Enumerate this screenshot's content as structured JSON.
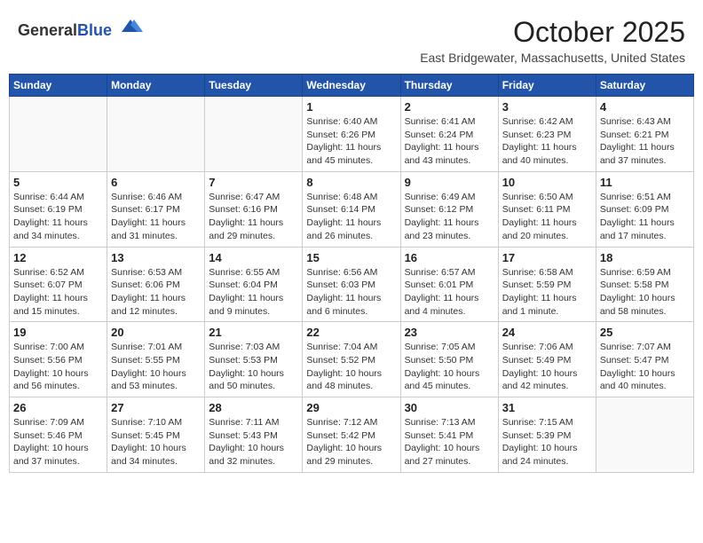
{
  "header": {
    "logo_general": "General",
    "logo_blue": "Blue",
    "month_title": "October 2025",
    "location": "East Bridgewater, Massachusetts, United States"
  },
  "weekdays": [
    "Sunday",
    "Monday",
    "Tuesday",
    "Wednesday",
    "Thursday",
    "Friday",
    "Saturday"
  ],
  "weeks": [
    [
      {
        "day": "",
        "info": ""
      },
      {
        "day": "",
        "info": ""
      },
      {
        "day": "",
        "info": ""
      },
      {
        "day": "1",
        "info": "Sunrise: 6:40 AM\nSunset: 6:26 PM\nDaylight: 11 hours\nand 45 minutes."
      },
      {
        "day": "2",
        "info": "Sunrise: 6:41 AM\nSunset: 6:24 PM\nDaylight: 11 hours\nand 43 minutes."
      },
      {
        "day": "3",
        "info": "Sunrise: 6:42 AM\nSunset: 6:23 PM\nDaylight: 11 hours\nand 40 minutes."
      },
      {
        "day": "4",
        "info": "Sunrise: 6:43 AM\nSunset: 6:21 PM\nDaylight: 11 hours\nand 37 minutes."
      }
    ],
    [
      {
        "day": "5",
        "info": "Sunrise: 6:44 AM\nSunset: 6:19 PM\nDaylight: 11 hours\nand 34 minutes."
      },
      {
        "day": "6",
        "info": "Sunrise: 6:46 AM\nSunset: 6:17 PM\nDaylight: 11 hours\nand 31 minutes."
      },
      {
        "day": "7",
        "info": "Sunrise: 6:47 AM\nSunset: 6:16 PM\nDaylight: 11 hours\nand 29 minutes."
      },
      {
        "day": "8",
        "info": "Sunrise: 6:48 AM\nSunset: 6:14 PM\nDaylight: 11 hours\nand 26 minutes."
      },
      {
        "day": "9",
        "info": "Sunrise: 6:49 AM\nSunset: 6:12 PM\nDaylight: 11 hours\nand 23 minutes."
      },
      {
        "day": "10",
        "info": "Sunrise: 6:50 AM\nSunset: 6:11 PM\nDaylight: 11 hours\nand 20 minutes."
      },
      {
        "day": "11",
        "info": "Sunrise: 6:51 AM\nSunset: 6:09 PM\nDaylight: 11 hours\nand 17 minutes."
      }
    ],
    [
      {
        "day": "12",
        "info": "Sunrise: 6:52 AM\nSunset: 6:07 PM\nDaylight: 11 hours\nand 15 minutes."
      },
      {
        "day": "13",
        "info": "Sunrise: 6:53 AM\nSunset: 6:06 PM\nDaylight: 11 hours\nand 12 minutes."
      },
      {
        "day": "14",
        "info": "Sunrise: 6:55 AM\nSunset: 6:04 PM\nDaylight: 11 hours\nand 9 minutes."
      },
      {
        "day": "15",
        "info": "Sunrise: 6:56 AM\nSunset: 6:03 PM\nDaylight: 11 hours\nand 6 minutes."
      },
      {
        "day": "16",
        "info": "Sunrise: 6:57 AM\nSunset: 6:01 PM\nDaylight: 11 hours\nand 4 minutes."
      },
      {
        "day": "17",
        "info": "Sunrise: 6:58 AM\nSunset: 5:59 PM\nDaylight: 11 hours\nand 1 minute."
      },
      {
        "day": "18",
        "info": "Sunrise: 6:59 AM\nSunset: 5:58 PM\nDaylight: 10 hours\nand 58 minutes."
      }
    ],
    [
      {
        "day": "19",
        "info": "Sunrise: 7:00 AM\nSunset: 5:56 PM\nDaylight: 10 hours\nand 56 minutes."
      },
      {
        "day": "20",
        "info": "Sunrise: 7:01 AM\nSunset: 5:55 PM\nDaylight: 10 hours\nand 53 minutes."
      },
      {
        "day": "21",
        "info": "Sunrise: 7:03 AM\nSunset: 5:53 PM\nDaylight: 10 hours\nand 50 minutes."
      },
      {
        "day": "22",
        "info": "Sunrise: 7:04 AM\nSunset: 5:52 PM\nDaylight: 10 hours\nand 48 minutes."
      },
      {
        "day": "23",
        "info": "Sunrise: 7:05 AM\nSunset: 5:50 PM\nDaylight: 10 hours\nand 45 minutes."
      },
      {
        "day": "24",
        "info": "Sunrise: 7:06 AM\nSunset: 5:49 PM\nDaylight: 10 hours\nand 42 minutes."
      },
      {
        "day": "25",
        "info": "Sunrise: 7:07 AM\nSunset: 5:47 PM\nDaylight: 10 hours\nand 40 minutes."
      }
    ],
    [
      {
        "day": "26",
        "info": "Sunrise: 7:09 AM\nSunset: 5:46 PM\nDaylight: 10 hours\nand 37 minutes."
      },
      {
        "day": "27",
        "info": "Sunrise: 7:10 AM\nSunset: 5:45 PM\nDaylight: 10 hours\nand 34 minutes."
      },
      {
        "day": "28",
        "info": "Sunrise: 7:11 AM\nSunset: 5:43 PM\nDaylight: 10 hours\nand 32 minutes."
      },
      {
        "day": "29",
        "info": "Sunrise: 7:12 AM\nSunset: 5:42 PM\nDaylight: 10 hours\nand 29 minutes."
      },
      {
        "day": "30",
        "info": "Sunrise: 7:13 AM\nSunset: 5:41 PM\nDaylight: 10 hours\nand 27 minutes."
      },
      {
        "day": "31",
        "info": "Sunrise: 7:15 AM\nSunset: 5:39 PM\nDaylight: 10 hours\nand 24 minutes."
      },
      {
        "day": "",
        "info": ""
      }
    ]
  ]
}
